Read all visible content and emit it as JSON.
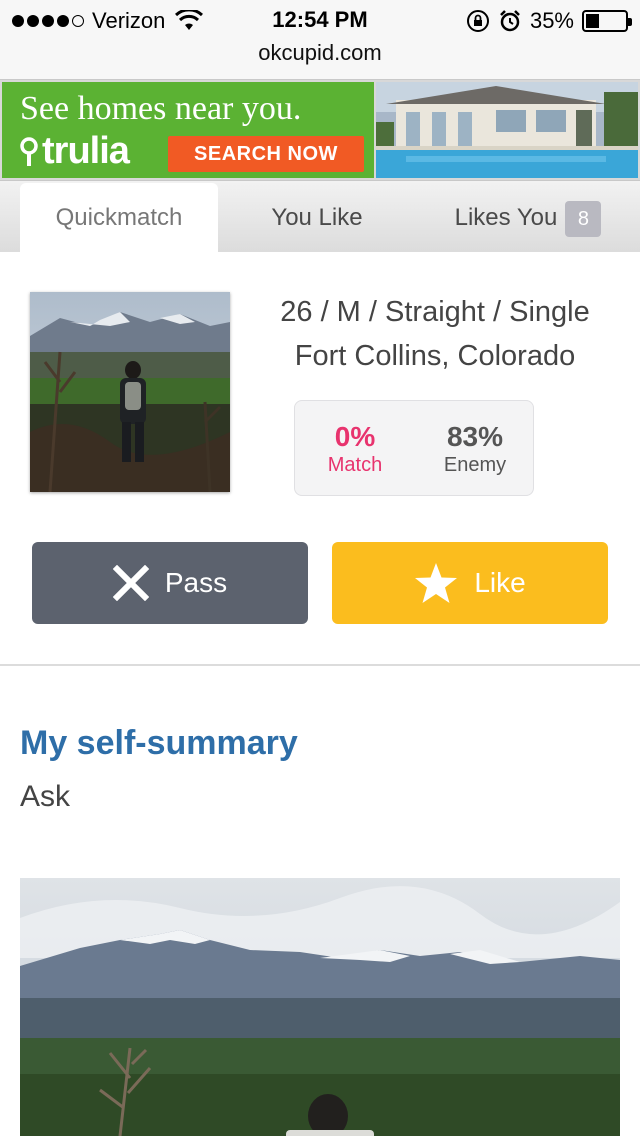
{
  "status_bar": {
    "carrier": "Verizon",
    "signal_bars": 4,
    "time": "12:54 PM",
    "battery_percent": "35%",
    "battery_level": 0.35
  },
  "url_bar": {
    "domain": "okcupid.com"
  },
  "ad": {
    "headline": "See homes near you.",
    "brand": "trulia",
    "cta": "SEARCH NOW",
    "colors": {
      "green": "#5bb233",
      "cta": "#f15a24"
    }
  },
  "tabs": [
    {
      "label": "Quickmatch",
      "active": true
    },
    {
      "label": "You Like",
      "active": false
    },
    {
      "label": "Likes You",
      "active": false,
      "badge": "8"
    }
  ],
  "profile": {
    "details": "26 / M / Straight / Single",
    "location": "Fort Collins, Colorado",
    "match_value": "0%",
    "match_label": "Match",
    "enemy_value": "83%",
    "enemy_label": "Enemy"
  },
  "actions": {
    "pass_label": "Pass",
    "like_label": "Like"
  },
  "self_summary": {
    "title": "My self-summary",
    "body": "Ask"
  },
  "colors": {
    "match": "#e8336e",
    "pass_button": "#5c626e",
    "like_button": "#fbbd1e",
    "section_title": "#2e6ea8"
  }
}
